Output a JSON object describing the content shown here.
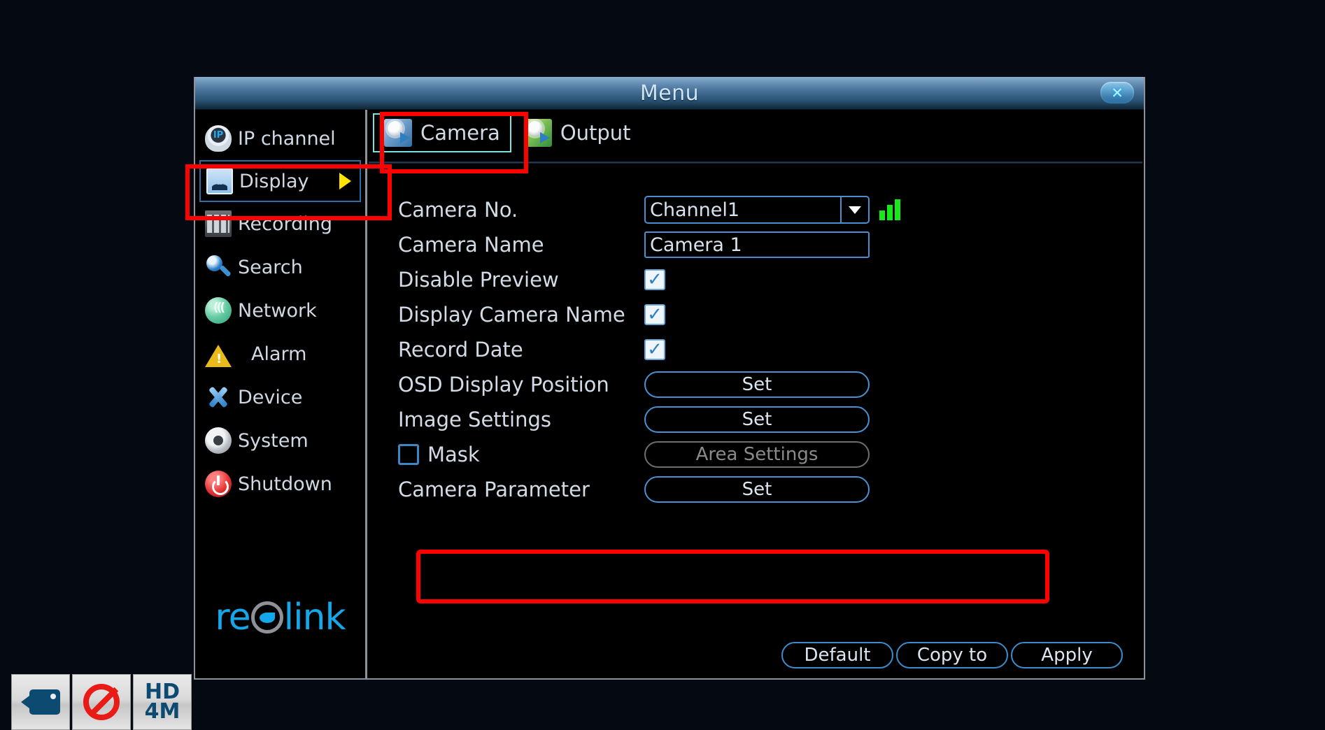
{
  "window": {
    "title": "Menu",
    "close_icon": "close-icon",
    "close_label": "✕"
  },
  "sidebar": {
    "items": [
      {
        "label": "IP channel",
        "icon": "ip-camera-icon",
        "active": false
      },
      {
        "label": "Display",
        "icon": "display-icon",
        "active": true
      },
      {
        "label": "Recording",
        "icon": "recording-icon",
        "active": false
      },
      {
        "label": "Search",
        "icon": "search-icon",
        "active": false
      },
      {
        "label": "Network",
        "icon": "network-icon",
        "active": false
      },
      {
        "label": "Alarm",
        "icon": "alarm-icon",
        "active": false
      },
      {
        "label": "Device",
        "icon": "device-icon",
        "active": false
      },
      {
        "label": "System",
        "icon": "system-icon",
        "active": false
      },
      {
        "label": "Shutdown",
        "icon": "shutdown-icon",
        "active": false
      }
    ],
    "logo": {
      "part1": "re",
      "part2": "link",
      "name": "reolink-logo"
    }
  },
  "tabs": [
    {
      "label": "Camera",
      "icon": "camera-settings-icon",
      "active": true
    },
    {
      "label": "Output",
      "icon": "output-settings-icon",
      "active": false
    }
  ],
  "form": {
    "camera_no": {
      "label": "Camera No.",
      "value": "Channel1",
      "options": [
        "Channel1"
      ],
      "signal_bars": 3
    },
    "camera_name": {
      "label": "Camera Name",
      "value": "Camera 1"
    },
    "disable_preview": {
      "label": "Disable Preview",
      "checked": true
    },
    "display_camera_name": {
      "label": "Display Camera Name",
      "checked": true
    },
    "record_date": {
      "label": "Record Date",
      "checked": true
    },
    "osd_display_position": {
      "label": "OSD Display Position",
      "button": "Set"
    },
    "image_settings": {
      "label": "Image Settings",
      "button": "Set"
    },
    "mask": {
      "label": "Mask",
      "checked": false,
      "button": "Area Settings",
      "button_disabled": true
    },
    "camera_parameter": {
      "label": "Camera Parameter",
      "button": "Set"
    }
  },
  "footer": {
    "default_label": "Default",
    "copy_to_label": "Copy to",
    "apply_label": "Apply"
  },
  "taskbar": {
    "items": [
      {
        "icon": "camcorder-icon",
        "label": ""
      },
      {
        "icon": "no-entry-icon",
        "label": ""
      },
      {
        "icon": "hd-resolution-icon",
        "line1": "HD",
        "line2": "4M"
      }
    ]
  },
  "annotations": {
    "accent_red": "#ff0000",
    "boxes": [
      "display-sidebar-item",
      "camera-tab",
      "camera-parameter-row"
    ]
  },
  "colors": {
    "accent_blue": "#4a90d0",
    "tab_highlight": "#7fe0e0",
    "caret_yellow": "#ffe400",
    "signal_green": "#17e817",
    "logo_cyan": "#14a7ea"
  }
}
